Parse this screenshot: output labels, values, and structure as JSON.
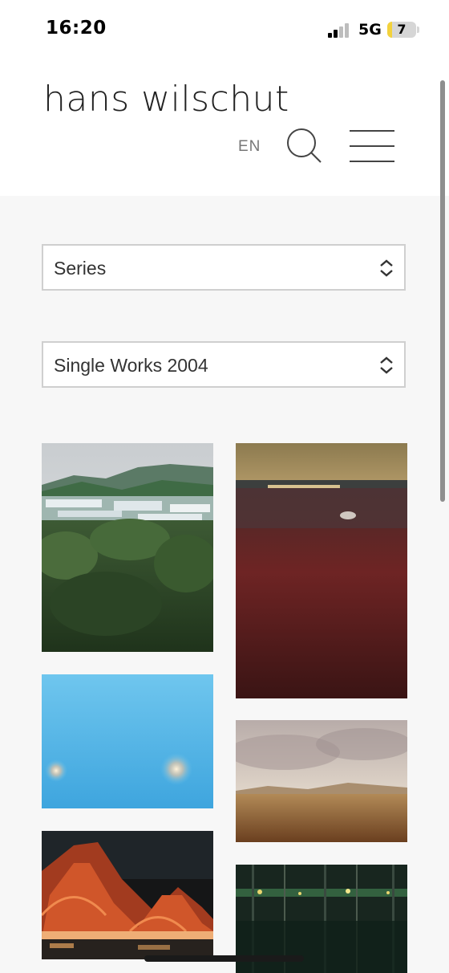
{
  "status_bar": {
    "time": "16:20",
    "network": "5G",
    "battery_level": "7"
  },
  "header": {
    "brand": "hans wilschut",
    "language": "EN",
    "search_icon": "search-icon",
    "menu_icon": "hamburger-menu-icon"
  },
  "filters": {
    "series_select": {
      "value": "Series"
    },
    "work_select": {
      "value": "Single Works 2004"
    }
  },
  "gallery": {
    "items": [
      {
        "name": "coastal-greenhouse-valley-photo"
      },
      {
        "name": "red-heath-harbor-dusk-photo"
      },
      {
        "name": "blue-haze-lights-photo"
      },
      {
        "name": "desert-plain-overcast-photo"
      },
      {
        "name": "illuminated-railway-bridge-night-photo"
      },
      {
        "name": "forest-city-lights-night-photo"
      }
    ]
  },
  "colors": {
    "page_background": "#f7f7f7",
    "header_background": "#ffffff",
    "select_border": "#cfcfcf",
    "text": "#333333"
  }
}
